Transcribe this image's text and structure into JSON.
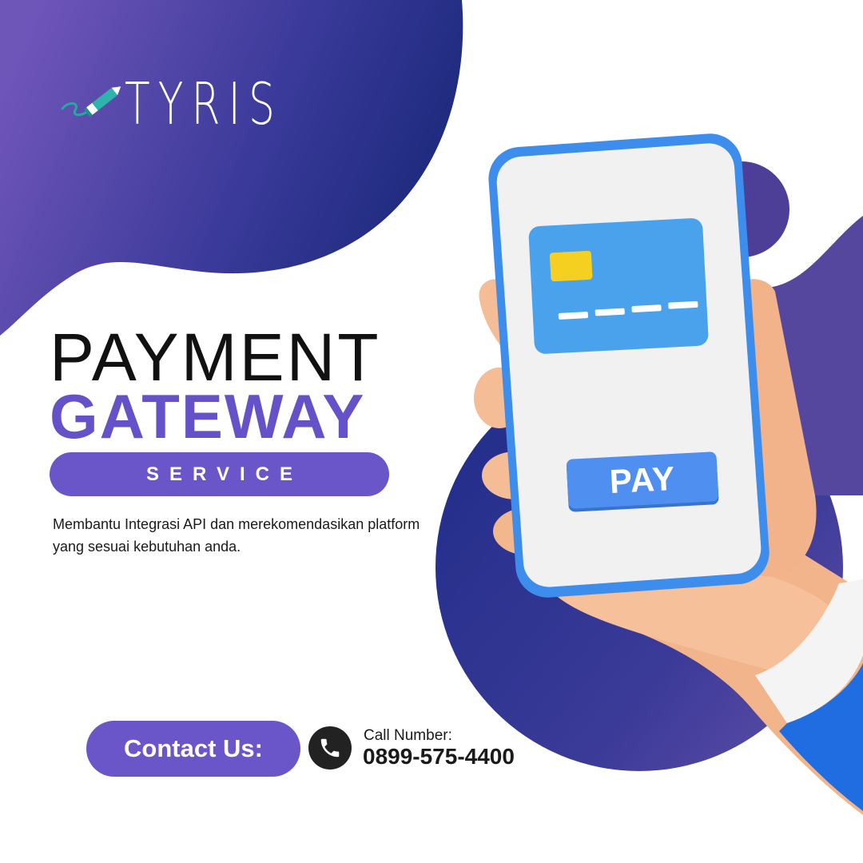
{
  "brand": {
    "name": "TYRIS",
    "logo_icon": "pen-icon"
  },
  "headline": {
    "line1": "PAYMENT",
    "line2": "GATEWAY",
    "tagline": "SERVICE"
  },
  "description": "Membantu Integrasi API dan merekomendasikan platform yang sesuai kebutuhan anda.",
  "phone_screen": {
    "button_label": "PAY",
    "card_icon": "credit-card-icon"
  },
  "contact": {
    "button_label": "Contact Us:",
    "call_label": "Call Number:",
    "phone_number": "0899-575-4400",
    "icon": "phone-icon"
  },
  "colors": {
    "accent_purple": "#6a55c9",
    "deep_navy": "#1f2a7a",
    "card_blue": "#4aa2ec",
    "pay_blue": "#4f8ff0",
    "chip_yellow": "#f5d020"
  }
}
